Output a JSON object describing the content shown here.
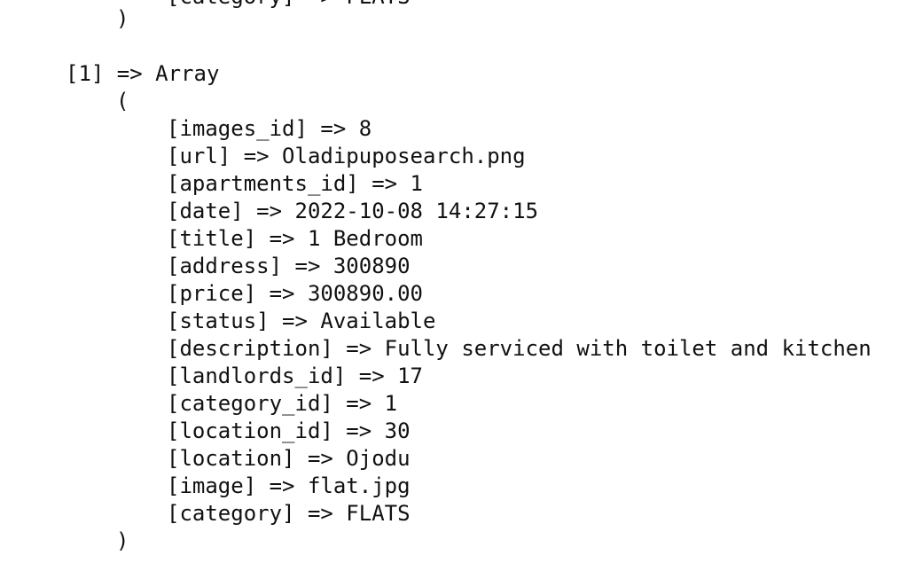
{
  "dump": {
    "clipped_prev_line": "[category] => FLATS",
    "prev_close": ")",
    "index_line": "[1] => Array",
    "open_paren": "(",
    "fields": [
      {
        "key": "images_id",
        "value": "8"
      },
      {
        "key": "url",
        "value": "Oladipuposearch.png"
      },
      {
        "key": "apartments_id",
        "value": "1"
      },
      {
        "key": "date",
        "value": "2022-10-08 14:27:15"
      },
      {
        "key": "title",
        "value": "1 Bedroom"
      },
      {
        "key": "address",
        "value": "300890"
      },
      {
        "key": "price",
        "value": "300890.00"
      },
      {
        "key": "status",
        "value": "Available"
      },
      {
        "key": "description",
        "value": "Fully serviced with toilet and kitchen"
      },
      {
        "key": "landlords_id",
        "value": "17"
      },
      {
        "key": "category_id",
        "value": "1"
      },
      {
        "key": "location_id",
        "value": "30"
      },
      {
        "key": "location",
        "value": "Ojodu"
      },
      {
        "key": "image",
        "value": "flat.jpg"
      },
      {
        "key": "category",
        "value": "FLATS"
      }
    ],
    "close_paren": ")"
  }
}
